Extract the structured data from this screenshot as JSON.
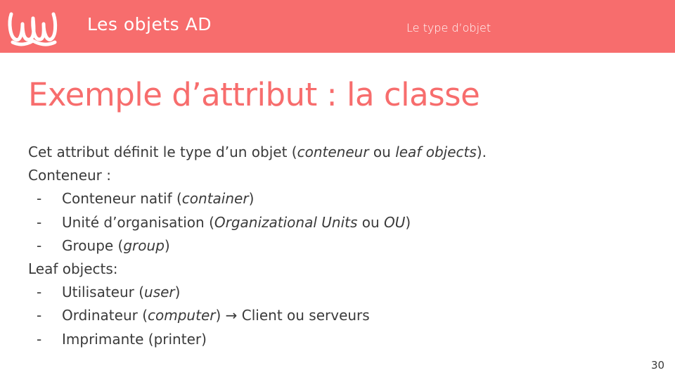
{
  "header": {
    "logo_icon": "wave-logo-icon",
    "title": "Les objets AD",
    "section": "Le type d’objet",
    "background_color": "#f76d6d"
  },
  "slide": {
    "title": "Exemple d’attribut : la classe",
    "title_color": "#f76d6d",
    "intro": {
      "t1": "Cet attribut définit le type d’un objet (",
      "i1": "conteneur",
      "t2": " ou ",
      "i2": "leaf objects",
      "t3": ")."
    },
    "conteneur_heading": "Conteneur :",
    "bullet_marker": "-",
    "conteneur_items": [
      {
        "t1": "Conteneur natif (",
        "i1": "container",
        "t2": ")"
      },
      {
        "t1": "Unité d’organisation (",
        "i1": "Organizational Units",
        "t2": " ou ",
        "i2": "OU",
        "t3": ")"
      },
      {
        "t1": "Groupe (",
        "i1": "group",
        "t2": ")"
      }
    ],
    "leaf_heading": "Leaf objects:",
    "leaf_items": [
      {
        "t1": "Utilisateur (",
        "i1": "user",
        "t2": ")"
      },
      {
        "t1": "Ordinateur (",
        "i1": "computer",
        "t2": ") → Client ou serveurs"
      },
      {
        "t1": "Imprimante (printer)"
      }
    ]
  },
  "footer": {
    "page_number": "30"
  }
}
